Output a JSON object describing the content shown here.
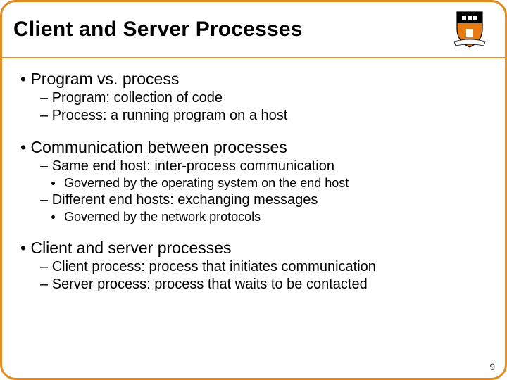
{
  "title": "Client and Server Processes",
  "page_number": "9",
  "bullets": {
    "b1_1": "Program vs. process",
    "b2_1a": "Program: collection of code",
    "b2_1b": "Process: a running program on a host",
    "b1_2": "Communication between processes",
    "b2_2a": "Same end host: inter-process communication",
    "b3_2a1": "Governed by the operating system on the end host",
    "b2_2b": "Different end hosts: exchanging messages",
    "b3_2b1": "Governed by the network protocols",
    "b1_3": "Client and server processes",
    "b2_3a": "Client process: process that initiates communication",
    "b2_3b": "Server process: process that waits to be contacted"
  },
  "crest": {
    "name": "princeton-shield-icon",
    "shield_fill": "#e67b14",
    "shield_stroke": "#000000",
    "banner_fill": "#ffffff"
  }
}
